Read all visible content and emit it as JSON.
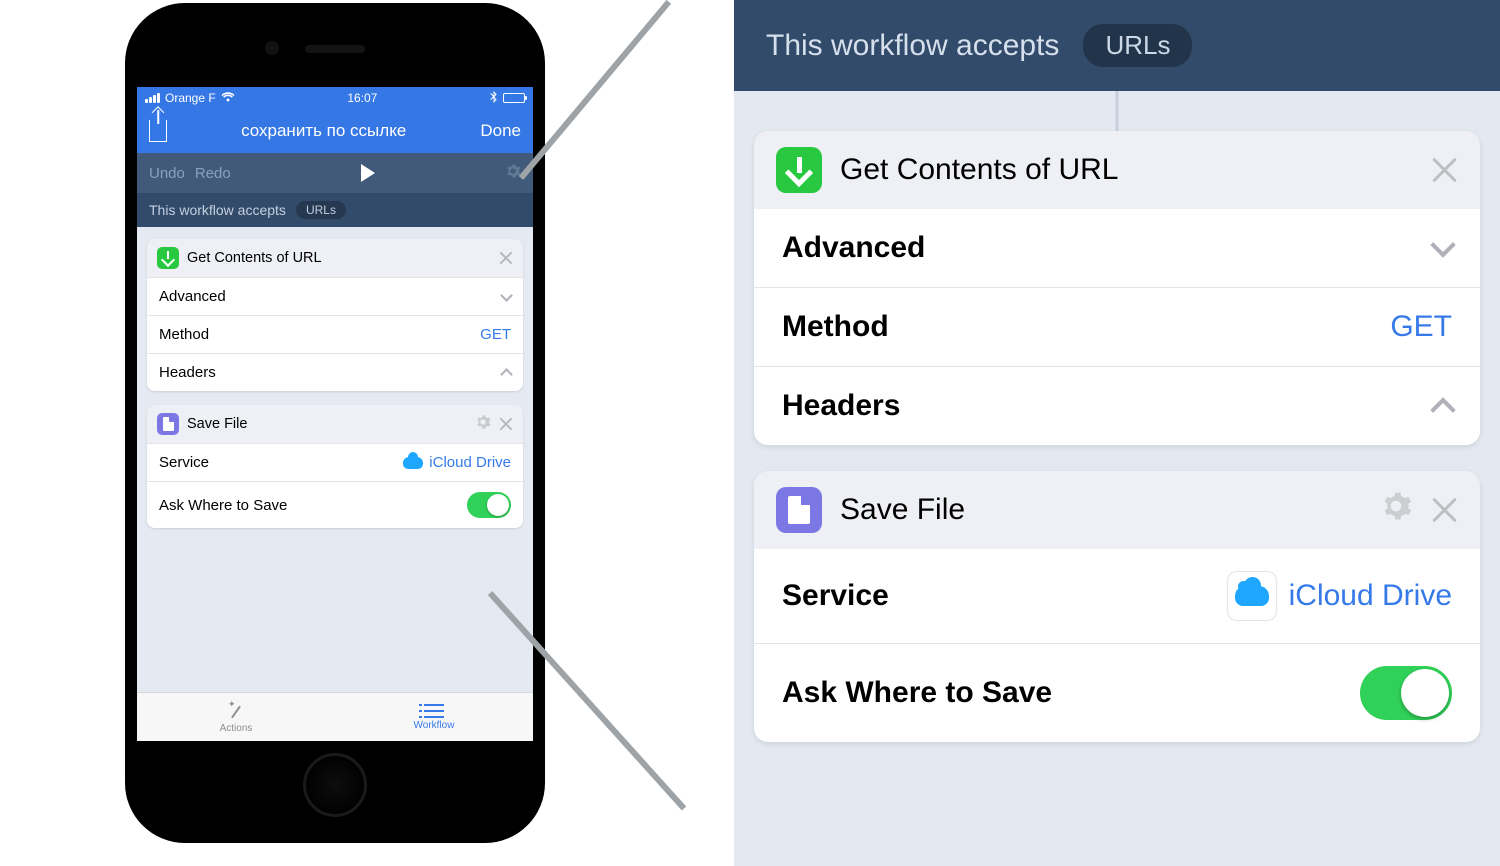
{
  "status_bar": {
    "carrier": "Orange F",
    "time": "16:07"
  },
  "nav": {
    "title": "сохранить по ссылке",
    "done": "Done"
  },
  "toolbar": {
    "undo": "Undo",
    "redo": "Redo"
  },
  "accepts": {
    "label": "This workflow accepts",
    "pill": "URLs"
  },
  "actions": [
    {
      "title": "Get Contents of URL",
      "rows": {
        "advanced": "Advanced",
        "method_label": "Method",
        "method_value": "GET",
        "headers": "Headers"
      }
    },
    {
      "title": "Save File",
      "rows": {
        "service_label": "Service",
        "service_value": "iCloud Drive",
        "ask_label": "Ask Where to Save",
        "ask_value": true
      }
    }
  ],
  "tabs": {
    "actions": "Actions",
    "workflow": "Workflow"
  }
}
